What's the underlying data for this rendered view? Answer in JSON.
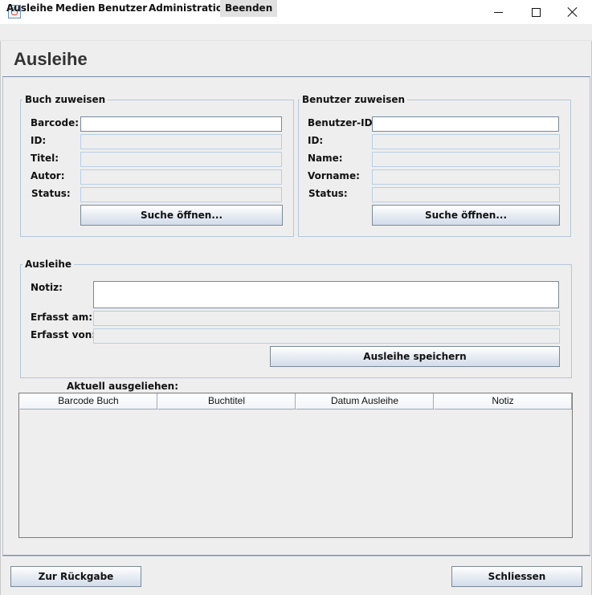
{
  "window": {
    "title_icon": "java-cup-icon",
    "controls": {
      "minimize": "minimize-icon",
      "maximize": "maximize-icon",
      "close": "close-icon"
    }
  },
  "menu": {
    "items": [
      {
        "label": "Ausleihe"
      },
      {
        "label": "Medien"
      },
      {
        "label": "Benutzer"
      },
      {
        "label": "Administration"
      },
      {
        "label": "Beenden"
      }
    ]
  },
  "page": {
    "title": "Ausleihe"
  },
  "buch": {
    "title": "Buch zuweisen",
    "labels": {
      "barcode": "Barcode:",
      "id": "ID:",
      "titel": "Titel:",
      "autor": "Autor:",
      "status": "Status:"
    },
    "values": {
      "barcode": "",
      "id": "",
      "titel": "",
      "autor": "",
      "status": ""
    },
    "search_button": "Suche öffnen..."
  },
  "benutzer": {
    "title": "Benutzer zuweisen",
    "labels": {
      "benutzer_id": "Benutzer-ID:",
      "id": "ID:",
      "name": "Name:",
      "vorname": "Vorname:",
      "status": "Status:"
    },
    "values": {
      "benutzer_id": "",
      "id": "",
      "name": "",
      "vorname": "",
      "status": ""
    },
    "search_button": "Suche öffnen..."
  },
  "ausleihe": {
    "title": "Ausleihe",
    "labels": {
      "notiz": "Notiz:",
      "erfasst_am": "Erfasst am:",
      "erfasst_von": "Erfasst von:"
    },
    "values": {
      "notiz": "",
      "erfasst_am": "",
      "erfasst_von": ""
    },
    "save_button": "Ausleihe speichern"
  },
  "table": {
    "label": "Aktuell ausgeliehen:",
    "columns": [
      "Barcode Buch",
      "Buchtitel",
      "Datum Ausleihe",
      "Notiz"
    ],
    "rows": []
  },
  "footer": {
    "back_button": "Zur Rückgabe",
    "close_button": "Schliessen"
  },
  "colors": {
    "background": "#eeeeee",
    "group_border": "#b6c7da",
    "button_gradient_bottom": "#d3dceb"
  }
}
